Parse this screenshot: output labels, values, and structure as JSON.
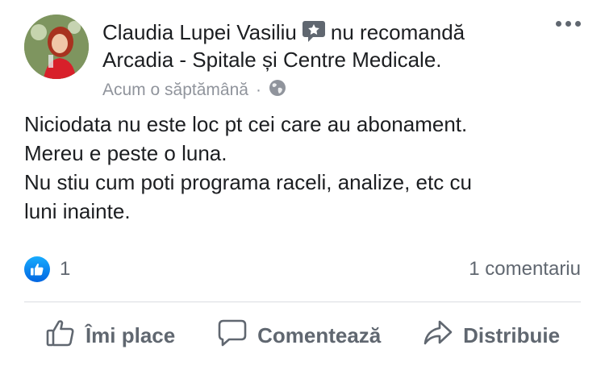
{
  "post": {
    "author": "Claudia Lupei Vasiliu",
    "recommends_text": "nu recomandă",
    "page_name": "Arcadia - Spitale și Centre Medicale.",
    "timestamp": "Acum o săptămână",
    "separator": "·",
    "icons": {
      "recommend": "recommendation-icon",
      "privacy": "globe-icon",
      "more": "more-options-icon",
      "like_badge": "like-reaction-icon"
    },
    "text_lines": [
      "Niciodata nu este loc pt cei care au abonament.",
      "Mereu e peste o luna.",
      "Nu stiu cum poti programa raceli, analize, etc cu",
      "luni inainte."
    ]
  },
  "stats": {
    "likes_count": "1",
    "comments_count": "1 comentariu"
  },
  "actions": {
    "like_label": "Îmi place",
    "comment_label": "Comentează",
    "share_label": "Distribuie"
  },
  "colors": {
    "text": "#1c1e21",
    "secondary": "#606770",
    "meta": "#90949c",
    "like_blue": "#0165e1",
    "divider": "#dadde1"
  }
}
